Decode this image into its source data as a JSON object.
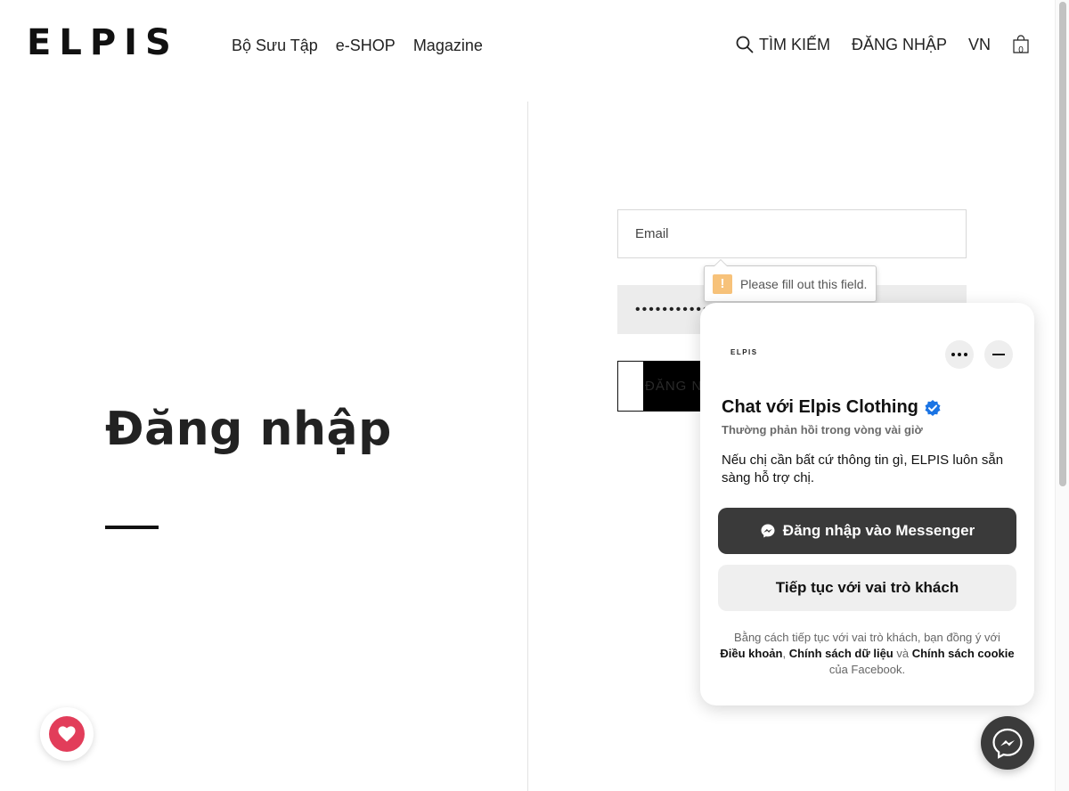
{
  "header": {
    "logo": "ELPIS",
    "nav": [
      {
        "label": "Bộ Sưu Tập"
      },
      {
        "label": "e-SHOP"
      },
      {
        "label": "Magazine"
      }
    ],
    "search_label": "TÌM KIẾM",
    "login_label": "ĐĂNG NHẬP",
    "lang_label": "VN",
    "cart_count": "0"
  },
  "main": {
    "title": "Đăng nhập"
  },
  "form": {
    "email_placeholder": "Email",
    "password_value": "•••••••••••",
    "submit_label": "ĐĂNG NHẬP",
    "validation_message": "Please fill out this field.",
    "validation_icon": "!"
  },
  "chat": {
    "brand_logo": "ELPIS",
    "title": "Chat với Elpis Clothing",
    "subtitle": "Thường phản hồi trong vòng vài giờ",
    "message": "Nếu chị cần bất cứ thông tin gì, ELPIS luôn sẵn sàng hỗ trợ chị.",
    "messenger_button": "Đăng nhập vào Messenger",
    "guest_button": "Tiếp tục với vai trò khách",
    "legal_prefix": "Bằng cách tiếp tục với vai trò khách, bạn đồng ý với",
    "legal_terms": "Điều khoản",
    "legal_sep1": ", ",
    "legal_data_policy": "Chính sách dữ liệu",
    "legal_and": " và ",
    "legal_cookie": "Chính sách cookie",
    "legal_suffix": " của Facebook."
  },
  "colors": {
    "accent_heart": "#e23d5a",
    "messenger_dark": "#3a3a3a",
    "verified_blue": "#1b74e4",
    "warning": "#f7c27a"
  }
}
